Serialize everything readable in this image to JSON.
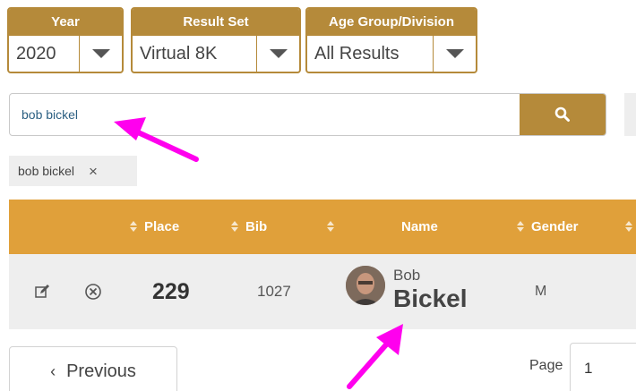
{
  "filters": {
    "year": {
      "label": "Year",
      "value": "2020"
    },
    "result_set": {
      "label": "Result Set",
      "value": "Virtual 8K"
    },
    "age_group": {
      "label": "Age Group/Division",
      "value": "All Results"
    }
  },
  "search": {
    "value": "bob bickel",
    "button_icon": "search-icon"
  },
  "search_chip": {
    "label": "bob bickel",
    "close": "×"
  },
  "table": {
    "columns": [
      {
        "key": "place",
        "label": "Place"
      },
      {
        "key": "bib",
        "label": "Bib"
      },
      {
        "key": "extra",
        "label": ""
      },
      {
        "key": "name",
        "label": "Name"
      },
      {
        "key": "gender",
        "label": "Gender"
      }
    ],
    "rows": [
      {
        "place": "229",
        "bib": "1027",
        "first_name": "Bob",
        "last_name": "Bickel",
        "gender": "M",
        "actions": [
          "edit-icon",
          "remove-circle-icon"
        ]
      }
    ]
  },
  "pagination": {
    "previous_label": "Previous",
    "page_label": "Page",
    "page_value": "1"
  },
  "colors": {
    "accent": "#b58a3a",
    "header": "#e0a03a",
    "row_bg": "#eeeeee",
    "annotation": "#ff00ee"
  }
}
